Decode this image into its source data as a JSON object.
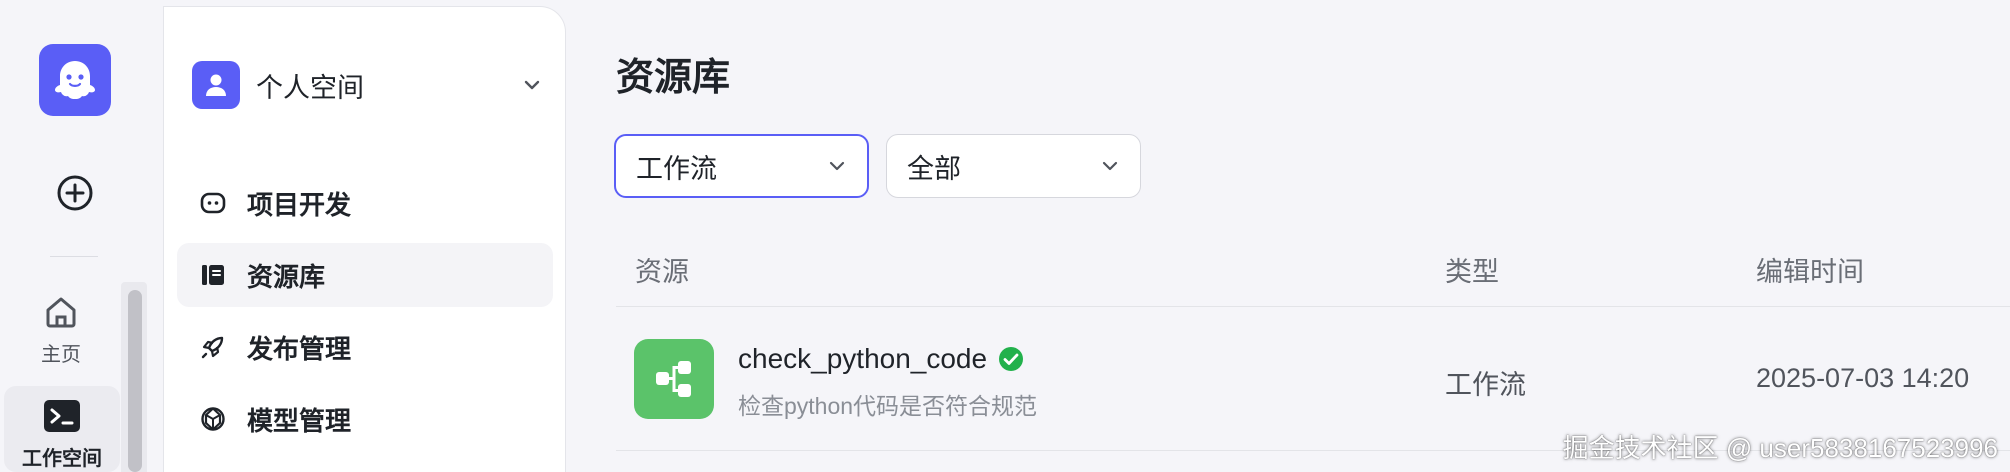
{
  "rail": {
    "logo_icon": "ghost-icon",
    "create_icon": "plus-circle-icon",
    "items": [
      {
        "label": "主页",
        "icon": "home-icon"
      },
      {
        "label": "工作空间",
        "icon": "terminal-icon"
      }
    ]
  },
  "sidebar": {
    "space_name": "个人空间",
    "space_icon": "user-icon",
    "items": [
      {
        "label": "项目开发",
        "icon": "bot-icon"
      },
      {
        "label": "资源库",
        "icon": "library-icon"
      },
      {
        "label": "发布管理",
        "icon": "rocket-icon"
      },
      {
        "label": "模型管理",
        "icon": "model-icon"
      }
    ]
  },
  "main": {
    "title": "资源库",
    "filters": {
      "type_value": "工作流",
      "scope_value": "全部"
    },
    "table": {
      "columns": [
        "资源",
        "类型",
        "编辑时间"
      ],
      "rows": [
        {
          "name": "check_python_code",
          "description": "检查python代码是否符合规范",
          "type": "工作流",
          "edited": "2025-07-03 14:20",
          "icon": "workflow-icon",
          "verified_icon": "check-circle-icon"
        }
      ]
    }
  },
  "watermark": "掘金技术社区 @ user5838167523996",
  "colors": {
    "accent": "#5a5ef6",
    "workflow_green": "#5bc36a",
    "verified_green": "#22b14c"
  }
}
